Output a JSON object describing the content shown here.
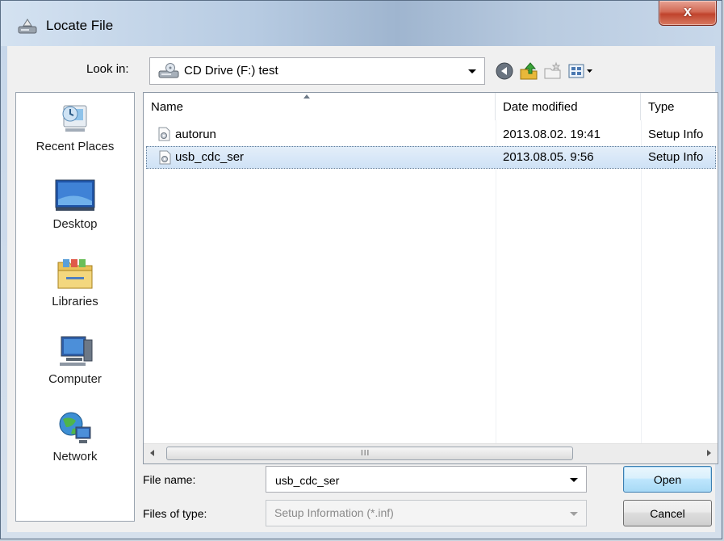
{
  "window": {
    "title": "Locate File",
    "close_label": "x"
  },
  "toolbar": {
    "look_in_label": "Look in:",
    "look_in_value": "CD Drive (F:) test"
  },
  "places": [
    {
      "label": "Recent Places",
      "icon": "recent-places-icon"
    },
    {
      "label": "Desktop",
      "icon": "desktop-icon"
    },
    {
      "label": "Libraries",
      "icon": "libraries-icon"
    },
    {
      "label": "Computer",
      "icon": "computer-icon"
    },
    {
      "label": "Network",
      "icon": "network-icon"
    }
  ],
  "columns": [
    {
      "label": "Name"
    },
    {
      "label": "Date modified"
    },
    {
      "label": "Type"
    }
  ],
  "files": [
    {
      "name": "autorun",
      "date": "2013.08.02. 19:41",
      "type": "Setup Info",
      "selected": false
    },
    {
      "name": "usb_cdc_ser",
      "date": "2013.08.05. 9:56",
      "type": "Setup Info",
      "selected": true
    }
  ],
  "scrollbar": {
    "grip": "III"
  },
  "form": {
    "file_name_label": "File name:",
    "file_name_value": "usb_cdc_ser",
    "files_of_type_label": "Files of type:",
    "files_of_type_value": "Setup Information (*.inf)"
  },
  "buttons": {
    "open": "Open",
    "cancel": "Cancel"
  },
  "colors": {
    "selection": "#cfe2f6",
    "title_close": "#c0432c",
    "default_button": "#3c7fb1"
  }
}
